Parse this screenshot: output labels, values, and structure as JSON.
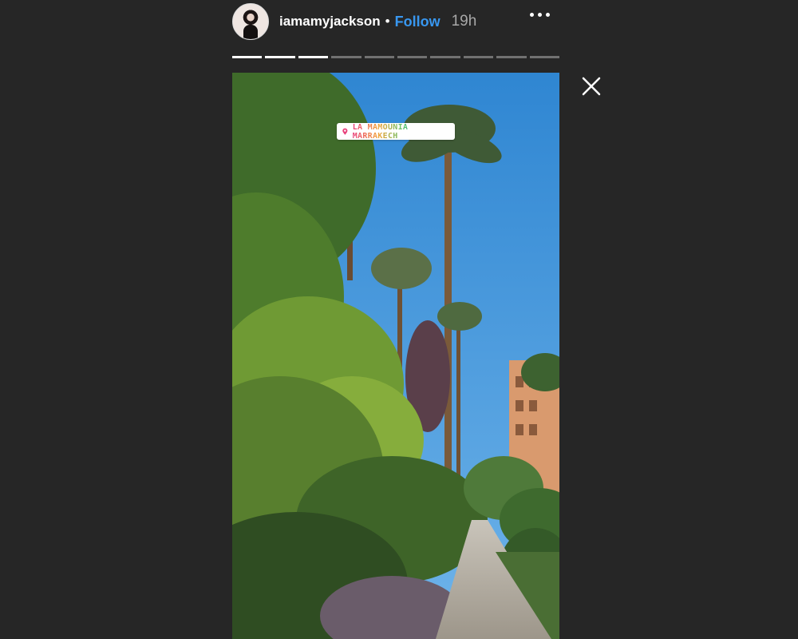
{
  "story": {
    "username": "iamamyjackson",
    "separator": "•",
    "follow_label": "Follow",
    "timestamp": "19h",
    "more_icon": "ellipsis-icon",
    "close_icon": "close-icon",
    "progress": {
      "total_segments": 10,
      "viewed_segments": 3
    }
  },
  "location_sticker": {
    "text": "LA MAMOUNIA MARRAKECH",
    "icon": "location-pin-icon"
  },
  "colors": {
    "background": "#262626",
    "follow": "#3897f0",
    "timestamp": "#a8a8a8",
    "sky": "#3f95d9"
  }
}
